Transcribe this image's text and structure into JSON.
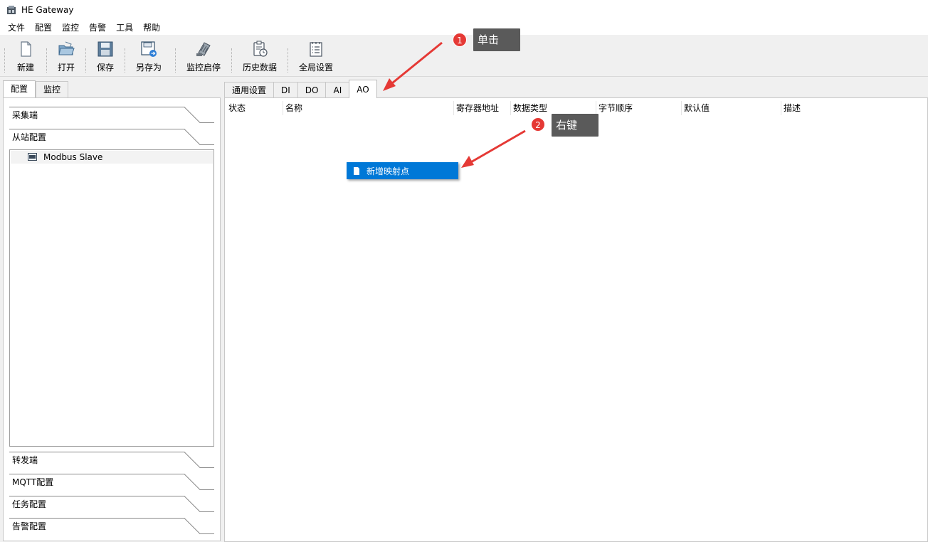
{
  "window": {
    "title": "HE Gateway"
  },
  "menu": [
    "文件",
    "配置",
    "监控",
    "告警",
    "工具",
    "帮助"
  ],
  "toolbar": [
    {
      "label": "新建",
      "icon": "new-file-icon"
    },
    {
      "label": "打开",
      "icon": "open-folder-icon"
    },
    {
      "label": "保存",
      "icon": "save-icon"
    },
    {
      "label": "另存为",
      "icon": "save-as-icon"
    },
    {
      "label": "监控启停",
      "icon": "monitor-toggle-icon"
    },
    {
      "label": "历史数据",
      "icon": "history-data-icon"
    },
    {
      "label": "全局设置",
      "icon": "global-settings-icon"
    }
  ],
  "left_tabs": [
    "配置",
    "监控"
  ],
  "left_sections": {
    "collect": "采集端",
    "slave": "从站配置",
    "forward": "转发端",
    "mqtt": "MQTT配置",
    "task": "任务配置",
    "alarm": "告警配置"
  },
  "slave_items": [
    {
      "label": "Modbus Slave",
      "icon": "modbus-device-icon"
    }
  ],
  "right_tabs": [
    "通用设置",
    "DI",
    "DO",
    "AI",
    "AO"
  ],
  "active_right_tab": "AO",
  "grid_columns": [
    "状态",
    "名称",
    "寄存器地址",
    "数据类型",
    "字节顺序",
    "默认值",
    "描述"
  ],
  "context_menu": {
    "items": [
      {
        "label": "新增映射点",
        "icon": "add-point-icon"
      }
    ]
  },
  "annotations": [
    {
      "number": "1",
      "text": "单击"
    },
    {
      "number": "2",
      "text": "右键"
    }
  ],
  "colors": {
    "selection": "#0078d7",
    "annotation_badge": "#e53935",
    "callout_bg": "#5a5a5a",
    "arrow": "#e53935"
  }
}
